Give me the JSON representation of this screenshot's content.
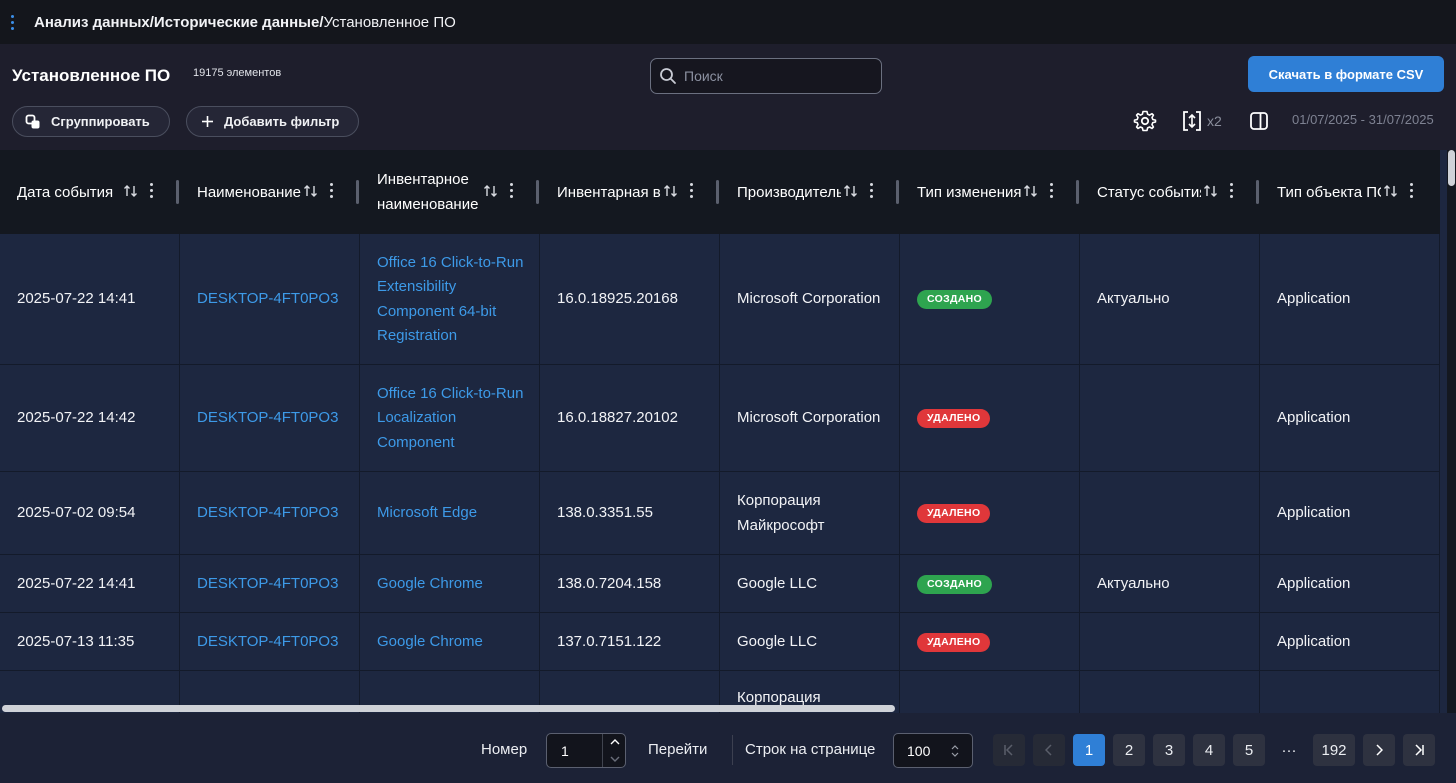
{
  "breadcrumb": {
    "part1": "Анализ данных",
    "sep": "/",
    "part2": "Исторические данные",
    "part3": "Установленное ПО"
  },
  "header": {
    "title": "Установленное ПО",
    "count": "19175 элементов",
    "search_placeholder": "Поиск",
    "csv_button": "Скачать в формате CSV",
    "group_button": "Сгруппировать",
    "filter_button": "Добавить фильтр",
    "density_label": "x2",
    "date_range": "01/07/2025 - 31/07/2025"
  },
  "icons": {
    "settings": "gear-icon",
    "density": "expand-vertical-icon",
    "columns": "panel-icon",
    "search": "search-icon",
    "group": "group-icon",
    "add": "plus-icon"
  },
  "columns": [
    {
      "label": "Дата события"
    },
    {
      "label": "Наименование"
    },
    {
      "label": "Инвентарное наименование"
    },
    {
      "label": "Инвентарная версия"
    },
    {
      "label": "Производитель"
    },
    {
      "label": "Тип изменения"
    },
    {
      "label": "Статус события"
    },
    {
      "label": "Тип объекта ПО"
    }
  ],
  "rows": [
    {
      "date": "2025-07-22 14:41",
      "name": "DESKTOP-4FT0PO3",
      "inv_name": "Office 16 Click-to-Run Extensibility Component 64-bit Registration",
      "version": "16.0.18925.20168",
      "vendor": "Microsoft Corporation",
      "change": "СОЗДАНО",
      "change_type": "created",
      "status": "Актуально",
      "obj_type": "Application"
    },
    {
      "date": "2025-07-22 14:42",
      "name": "DESKTOP-4FT0PO3",
      "inv_name": "Office 16 Click-to-Run Localization Component",
      "version": "16.0.18827.20102",
      "vendor": "Microsoft Corporation",
      "change": "УДАЛЕНО",
      "change_type": "deleted",
      "status": "",
      "obj_type": "Application"
    },
    {
      "date": "2025-07-02 09:54",
      "name": "DESKTOP-4FT0PO3",
      "inv_name": "Microsoft Edge",
      "version": "138.0.3351.55",
      "vendor": "Корпорация Майкрософт",
      "change": "УДАЛЕНО",
      "change_type": "deleted",
      "status": "",
      "obj_type": "Application"
    },
    {
      "date": "2025-07-22 14:41",
      "name": "DESKTOP-4FT0PO3",
      "inv_name": "Google Chrome",
      "version": "138.0.7204.158",
      "vendor": "Google LLC",
      "change": "СОЗДАНО",
      "change_type": "created",
      "status": "Актуально",
      "obj_type": "Application"
    },
    {
      "date": "2025-07-13 11:35",
      "name": "DESKTOP-4FT0PO3",
      "inv_name": "Google Chrome",
      "version": "137.0.7151.122",
      "vendor": "Google LLC",
      "change": "УДАЛЕНО",
      "change_type": "deleted",
      "status": "",
      "obj_type": "Application"
    },
    {
      "date": "",
      "name": "",
      "inv_name": "",
      "version": "",
      "vendor": "Корпорация",
      "change": "",
      "change_type": "deleted",
      "status": "",
      "obj_type": ""
    }
  ],
  "pagination": {
    "number_label": "Номер",
    "number_value": "1",
    "go_label": "Перейти",
    "rows_label": "Строк на странице",
    "rows_value": "100",
    "pages": [
      "1",
      "2",
      "3",
      "4",
      "5"
    ],
    "ellipsis": "···",
    "last_page": "192",
    "current": "1"
  },
  "colors": {
    "accent": "#2f7fd6",
    "created": "#2ea44f",
    "deleted": "#e0373a",
    "link": "#3d9ae8"
  }
}
